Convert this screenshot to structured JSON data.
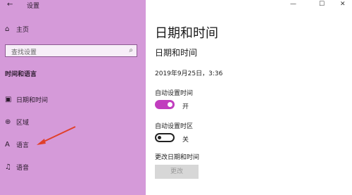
{
  "app": {
    "title": "设置"
  },
  "window_controls": {
    "minimize": "—",
    "maximize": "☐",
    "close": "✕"
  },
  "sidebar": {
    "home_label": "主页",
    "search_placeholder": "查找设置",
    "section_heading": "时间和语言",
    "items": [
      {
        "label": "日期和时间",
        "icon": "calendar-clock-icon"
      },
      {
        "label": "区域",
        "icon": "globe-icon"
      },
      {
        "label": "语言",
        "icon": "language-icon"
      },
      {
        "label": "语音",
        "icon": "microphone-icon"
      }
    ]
  },
  "main": {
    "page_title": "日期和时间",
    "section_title": "日期和时间",
    "current_datetime": "2019年9月25日，3:36",
    "auto_time_label": "自动设置时间",
    "auto_time_state": "开",
    "auto_zone_label": "自动设置时区",
    "auto_zone_state": "关",
    "change_label": "更改日期和时间",
    "change_button": "更改"
  },
  "colors": {
    "sidebar_bg": "#d59ad9",
    "accent": "#c13dbe",
    "arrow": "#e0402a"
  }
}
